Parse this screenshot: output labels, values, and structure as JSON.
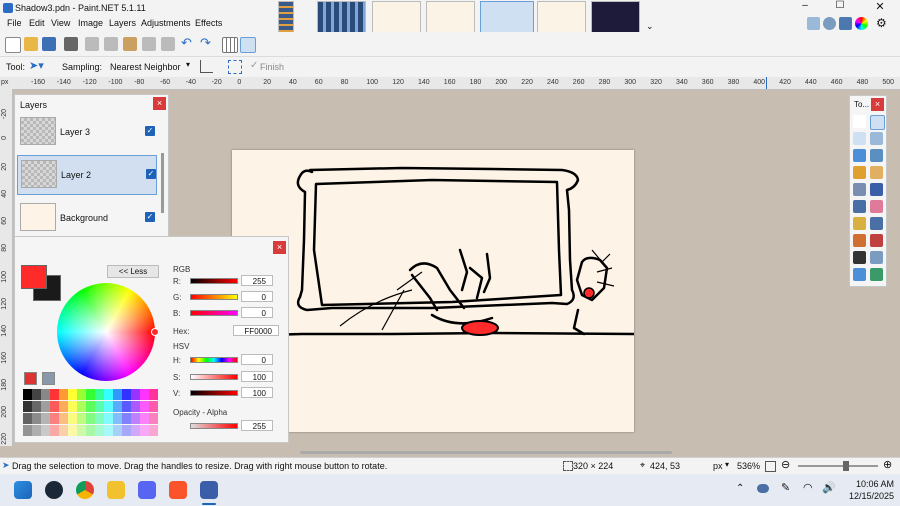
{
  "window": {
    "title": "Shadow3.pdn - Paint.NET 5.1.11"
  },
  "menu": [
    "File",
    "Edit",
    "View",
    "Image",
    "Layers",
    "Adjustments",
    "Effects"
  ],
  "tool_options": {
    "tool_label": "Tool:",
    "sampling_label": "Sampling:",
    "sampling_value": "Nearest Neighbor",
    "finish_label": "Finish"
  },
  "ruler": {
    "unit": "px",
    "h_ticks": [
      "-160",
      "-140",
      "-120",
      "-100",
      "-80",
      "-60",
      "-40",
      "-20",
      "0",
      "20",
      "40",
      "60",
      "80",
      "100",
      "120",
      "140",
      "160",
      "180",
      "200",
      "220",
      "240",
      "260",
      "280",
      "300",
      "320",
      "340",
      "360",
      "380",
      "400",
      "420",
      "440",
      "460",
      "480",
      "500"
    ],
    "v_ticks": [
      "-20",
      "0",
      "20",
      "40",
      "60",
      "80",
      "100",
      "120",
      "140",
      "160",
      "180",
      "200",
      "220"
    ]
  },
  "layers_panel": {
    "title": "Layers",
    "layers": [
      {
        "name": "Layer 3",
        "visible": true
      },
      {
        "name": "Layer 2",
        "visible": true,
        "selected": true
      },
      {
        "name": "Background",
        "visible": true
      }
    ]
  },
  "colors_panel": {
    "less_button": "<< Less",
    "rgb_label": "RGB",
    "r_label": "R:",
    "r_value": "255",
    "g_label": "G:",
    "g_value": "0",
    "b_label": "B:",
    "b_value": "0",
    "hex_label": "Hex:",
    "hex_value": "FF0000",
    "hsv_label": "HSV",
    "h_label": "H:",
    "h_value": "0",
    "s_label": "S:",
    "s_value": "100",
    "v_label": "V:",
    "v_value": "100",
    "opacity_label": "Opacity - Alpha",
    "opacity_value": "255",
    "primary_color": "#ff2a2a",
    "secondary_color": "#1a1a1a"
  },
  "tools_panel": {
    "title": "To..."
  },
  "status": {
    "hint": "Drag the selection to move. Drag the handles to resize. Drag with right mouse button to rotate.",
    "selection_size": "320 × 224",
    "cursor_pos": "424, 53",
    "unit": "px",
    "zoom": "536%"
  },
  "taskbar": {
    "time": "10:06 AM",
    "date": "12/15/2025"
  }
}
